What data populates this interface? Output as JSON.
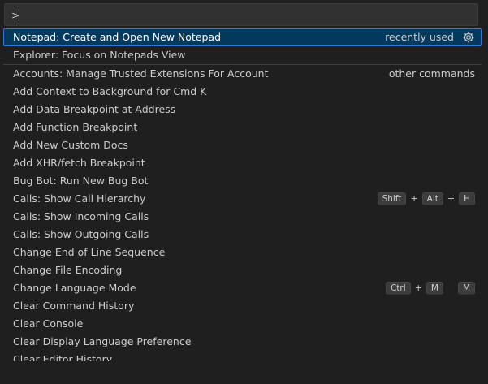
{
  "input": {
    "value": ">"
  },
  "items": [
    {
      "label": "Notepad: Create and Open New Notepad",
      "group": "recently used",
      "selected": true,
      "gear": true
    },
    {
      "label": "Explorer: Focus on Notepads View"
    },
    {
      "label": "Accounts: Manage Trusted Extensions For Account",
      "group": "other commands",
      "separator_before": true
    },
    {
      "label": "Add Context to Background for Cmd K"
    },
    {
      "label": "Add Data Breakpoint at Address"
    },
    {
      "label": "Add Function Breakpoint"
    },
    {
      "label": "Add New Custom Docs"
    },
    {
      "label": "Add XHR/fetch Breakpoint"
    },
    {
      "label": "Bug Bot: Run New Bug Bot"
    },
    {
      "label": "Calls: Show Call Hierarchy",
      "keys": [
        "Shift",
        "+",
        "Alt",
        "+",
        "H"
      ]
    },
    {
      "label": "Calls: Show Incoming Calls"
    },
    {
      "label": "Calls: Show Outgoing Calls"
    },
    {
      "label": "Change End of Line Sequence"
    },
    {
      "label": "Change File Encoding"
    },
    {
      "label": "Change Language Mode",
      "keys": [
        "Ctrl",
        "+",
        "M",
        " ",
        "M"
      ]
    },
    {
      "label": "Clear Command History"
    },
    {
      "label": "Clear Console"
    },
    {
      "label": "Clear Display Language Preference"
    },
    {
      "label": "Clear Editor History"
    }
  ],
  "colors": {
    "background": "#1f1f1f",
    "selected_background": "#04395e",
    "selected_border": "#2b79d8",
    "text": "#cccccc"
  },
  "icons": {
    "gear": "gear-icon"
  }
}
